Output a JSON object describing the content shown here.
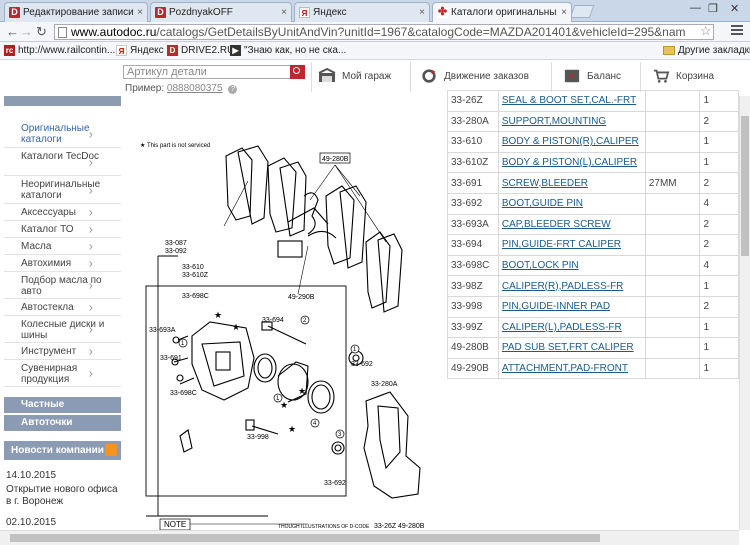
{
  "tabs": [
    {
      "label": "Редактирование записи",
      "active": false
    },
    {
      "label": "PozdnyakOFF",
      "active": false
    },
    {
      "label": "Яндекс",
      "active": false
    },
    {
      "label": "Каталоги оригинальных за",
      "active": true
    }
  ],
  "address": {
    "host": "www.autodoc.ru",
    "path": "/catalogs/GetDetailsByUnitAndVin?unitId=1967&catalogCode=MAZDA201401&vehicleId=295&nam"
  },
  "bookmarks": [
    {
      "label": "http://www.railcontin...",
      "icon": "rc-icon"
    },
    {
      "label": "Яндекс",
      "icon": "yandex-icon"
    },
    {
      "label": "DRIVE2.RU",
      "icon": "drive2-icon"
    },
    {
      "label": "\"Знаю как, но не ска...",
      "icon": "video-icon"
    },
    {
      "label": "Другие закладки",
      "icon": "folder-icon"
    }
  ],
  "header": {
    "search_placeholder": "Артикул детали",
    "example_label": "Пример:",
    "example_value": "0888080375",
    "garage": "Мой гараж",
    "orders": "Движение заказов",
    "balance": "Баланс",
    "cart": "Корзина"
  },
  "sidebar": {
    "items": [
      "Оригинальные каталоги",
      "Каталоги TecDoc",
      "Неоригинальные каталоги",
      "Аксессуары",
      "Каталог ТО",
      "Масла",
      "Автохимия",
      "Подбор масла по авто",
      "Автостекла",
      "Колесные диски и шины",
      "Инструмент",
      "Сувенирная продукция"
    ],
    "private_ads": "Частные объявления",
    "autopoints": "Автоточки",
    "news_title": "Новости компании",
    "news": [
      {
        "date": "14.10.2015",
        "text": "Открытие нового офиса в г. Воронеж"
      },
      {
        "date": "02.10.2015",
        "text": ""
      }
    ]
  },
  "diagram": {
    "not_serviced": "This part is not serviced",
    "note": "NOTE",
    "bottom_text": "THOUGH ILLUSTRATIONS OF D-CODE",
    "labels": [
      "49-280B",
      "33-087",
      "33-092",
      "33-610",
      "33-610Z",
      "33-698C",
      "33-693A",
      "33-691",
      "33-694",
      "49-290B",
      "33-692",
      "33-280A",
      "33-698C",
      "33-998",
      "33-692",
      "33-26Z",
      "49-280B"
    ]
  },
  "parts": [
    {
      "code": "33-26Z",
      "name": "SEAL & BOOT SET,CAL.-FRT",
      "note": "",
      "qty": "1"
    },
    {
      "code": "33-280A",
      "name": "SUPPORT,MOUNTING",
      "note": "",
      "qty": "2"
    },
    {
      "code": "33-610",
      "name": "BODY & PISTON(R),CALIPER",
      "note": "",
      "qty": "1"
    },
    {
      "code": "33-610Z",
      "name": "BODY & PISTON(L),CALIPER",
      "note": "",
      "qty": "1"
    },
    {
      "code": "33-691",
      "name": "SCREW,BLEEDER",
      "note": "27MM",
      "qty": "2"
    },
    {
      "code": "33-692",
      "name": "BOOT,GUIDE PIN",
      "note": "",
      "qty": "4"
    },
    {
      "code": "33-693A",
      "name": "CAP,BLEEDER SCREW",
      "note": "",
      "qty": "2"
    },
    {
      "code": "33-694",
      "name": "PIN,GUIDE-FRT CALIPER",
      "note": "",
      "qty": "2"
    },
    {
      "code": "33-698C",
      "name": "BOOT,LOCK PIN",
      "note": "",
      "qty": "4"
    },
    {
      "code": "33-98Z",
      "name": "CALIPER(R),PADLESS-FR",
      "note": "",
      "qty": "1"
    },
    {
      "code": "33-998",
      "name": "PIN,GUIDE-INNER PAD",
      "note": "",
      "qty": "2"
    },
    {
      "code": "33-99Z",
      "name": "CALIPER(L),PADLESS-FR",
      "note": "",
      "qty": "1"
    },
    {
      "code": "49-280B",
      "name": "PAD SUB SET,FRT CALIPER",
      "note": "",
      "qty": "1"
    },
    {
      "code": "49-290B",
      "name": "ATTACHMENT,PAD-FRONT",
      "note": "",
      "qty": "1"
    }
  ]
}
